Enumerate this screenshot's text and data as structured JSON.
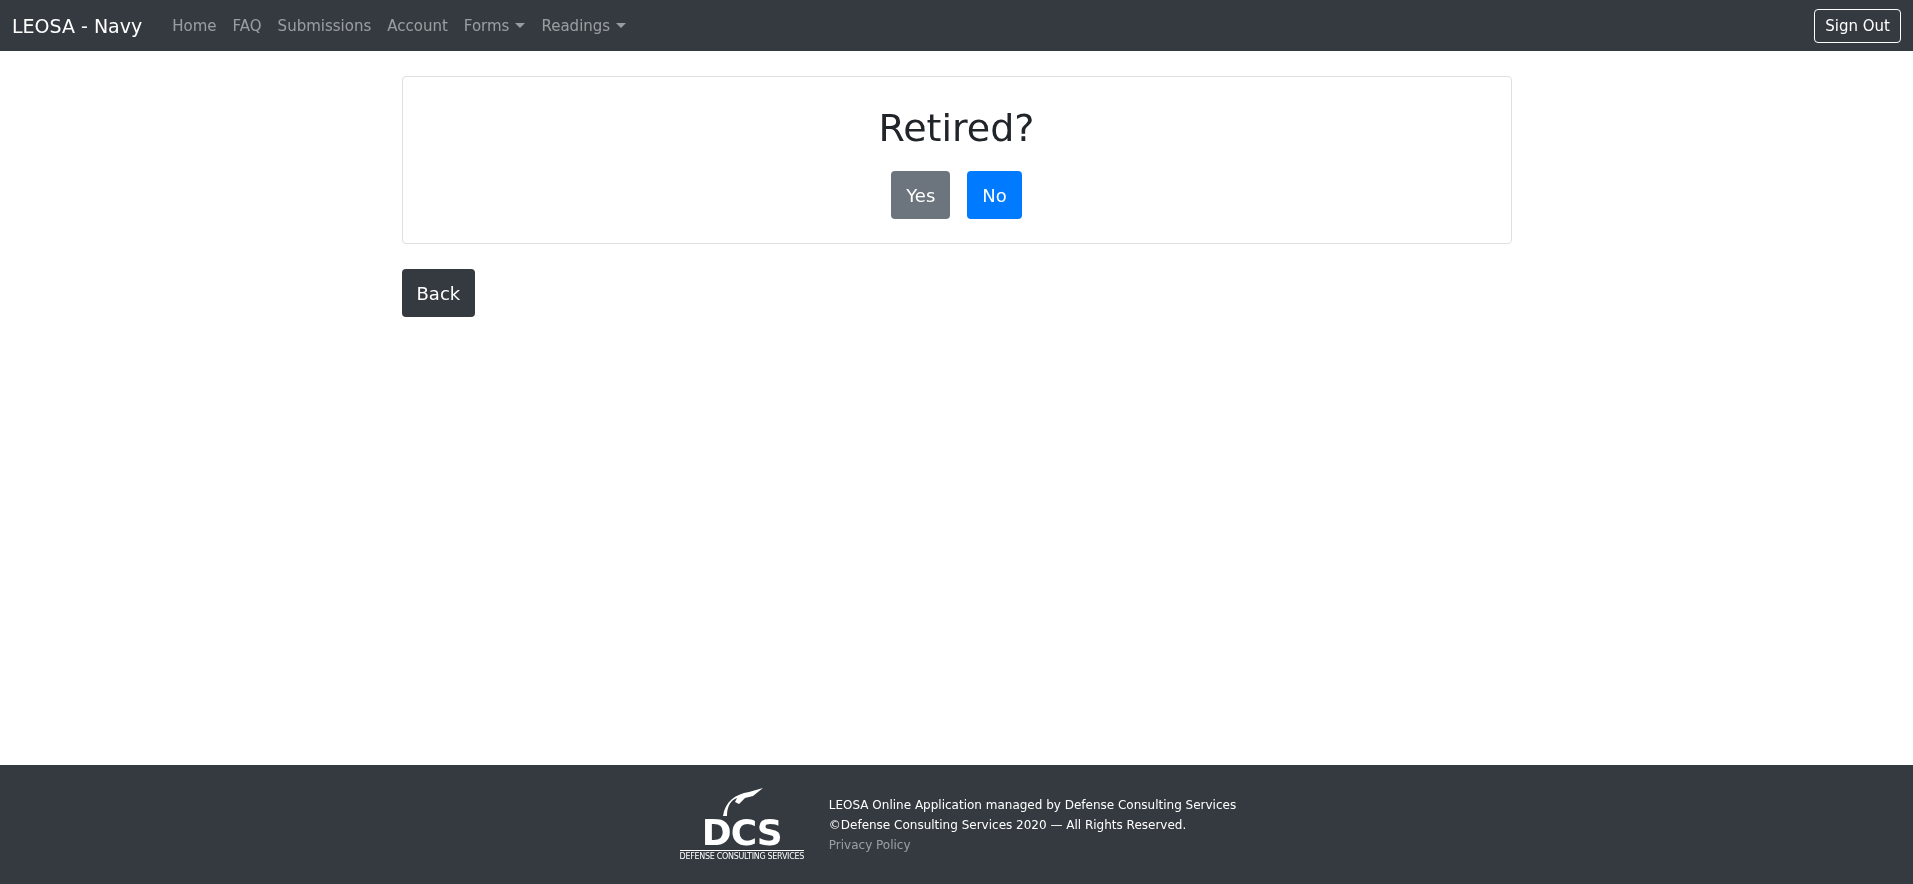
{
  "navbar": {
    "brand": "LEOSA - Navy",
    "items": [
      {
        "label": "Home",
        "dropdown": false
      },
      {
        "label": "FAQ",
        "dropdown": false
      },
      {
        "label": "Submissions",
        "dropdown": false
      },
      {
        "label": "Account",
        "dropdown": false
      },
      {
        "label": "Forms",
        "dropdown": true
      },
      {
        "label": "Readings",
        "dropdown": true
      }
    ],
    "sign_out": "Sign Out"
  },
  "card": {
    "title": "Retired?",
    "buttons": [
      {
        "label": "Yes",
        "kind": "secondary"
      },
      {
        "label": "No",
        "kind": "primary"
      }
    ]
  },
  "back_button": "Back",
  "footer": {
    "logo": {
      "mark": "DCS",
      "tagline": "DEFENSE CONSULTING SERVICES"
    },
    "lines": [
      "LEOSA Online Application managed by Defense Consulting Services",
      "©Defense Consulting Services 2020 — All Rights Reserved."
    ],
    "privacy_link": "Privacy Policy"
  }
}
